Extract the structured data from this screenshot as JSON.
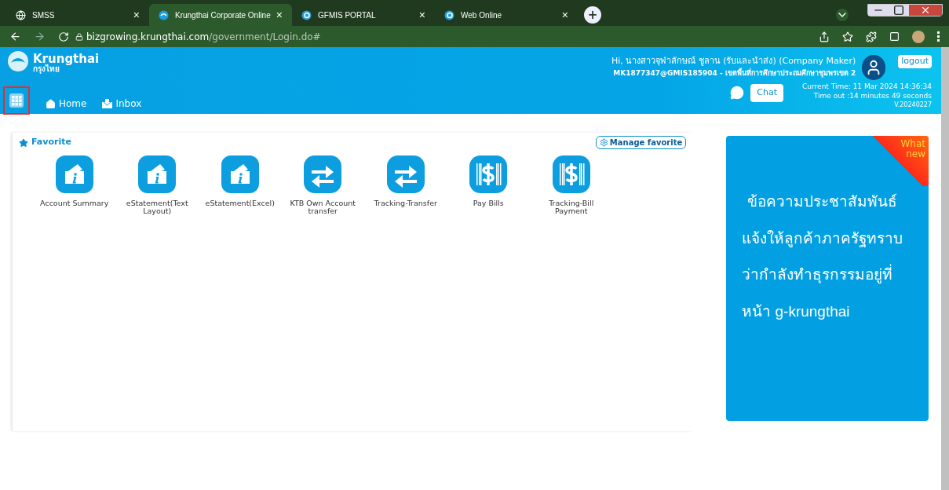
{
  "browser": {
    "tabs": [
      {
        "title": "SMSS",
        "close": "×",
        "selected": false
      },
      {
        "title": "Krungthai Corporate Online",
        "close": "×",
        "selected": true
      },
      {
        "title": "GFMIS PORTAL",
        "close": "×",
        "selected": false
      },
      {
        "title": "Web Online",
        "close": "×",
        "selected": false
      }
    ],
    "new_tab": "+",
    "address_host": "bizgrowing.krungthai.com",
    "address_path": "/government/Login.do#"
  },
  "header": {
    "brand": "Krungthai",
    "brand_thai": "กรุงไทย",
    "greeting": "Hi, นางสาวจุฬาลักษณ์ ชูลาน (รับและนำส่ง) (Company Maker)",
    "account": "MK1877347@GMIS185904 - เขตพื้นที่การศึกษาประถมศึกษาชุมพรเขต 2",
    "logout": "logout",
    "chat": "Chat",
    "current_time": "Current Time: 11 Mar 2024 14:36:34",
    "timeout": "Time out :14 minutes 49 seconds",
    "version": "V.20240227",
    "nav": [
      {
        "label": "Home"
      },
      {
        "label": "Inbox"
      }
    ]
  },
  "favorite": {
    "title": "Favorite",
    "manage": "Manage favorite",
    "items": [
      {
        "label": "Account Summary",
        "kind": "info"
      },
      {
        "label": "eStatement(Text Layout)",
        "kind": "info"
      },
      {
        "label": "eStatement(Excel)",
        "kind": "info"
      },
      {
        "label": "KTB Own Account transfer",
        "kind": "transfer"
      },
      {
        "label": "Tracking-Transfer",
        "kind": "transfer"
      },
      {
        "label": "Pay Bills",
        "kind": "dollar"
      },
      {
        "label": "Tracking-Bill Payment",
        "kind": "dollar"
      }
    ]
  },
  "news": {
    "ribbon_line1": "What",
    "ribbon_line2": "new",
    "lines": [
      "ข้อความประชาสัมพันธ์",
      "แจ้งให้ลูกค้าภาครัฐทราบ",
      "ว่ากำลังทำธุรกรรมอยู่ที่",
      "หน้า g-krungthai"
    ]
  }
}
